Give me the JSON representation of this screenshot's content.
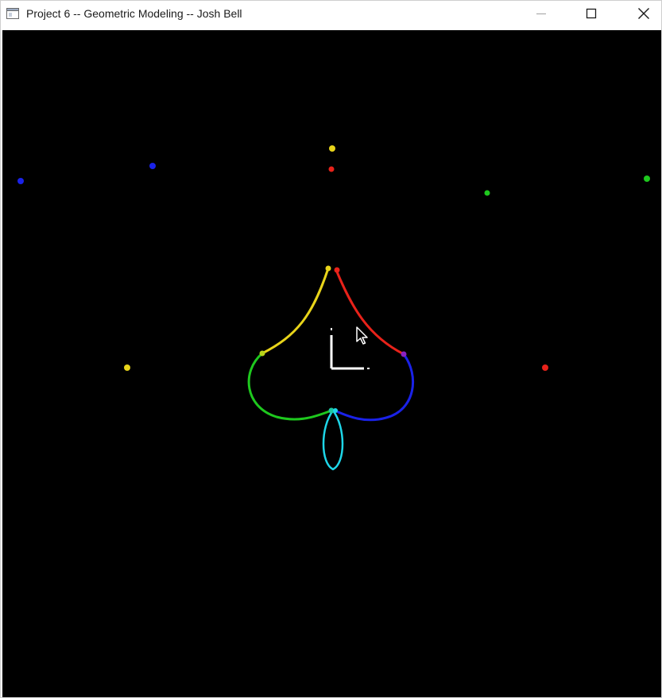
{
  "window": {
    "title": "Project 6 -- Geometric Modeling -- Josh Bell",
    "controls": {
      "minimize_icon": "minimize-icon",
      "maximize_icon": "maximize-icon",
      "close_icon": "close-icon"
    }
  },
  "scene": {
    "background": "#000000",
    "curve_colors": {
      "yellow": "#e8d41a",
      "red": "#e8221a",
      "green": "#1ec81e",
      "blue": "#1a22e8",
      "cyan": "#1ed6e8"
    },
    "axes_color": "#ffffff",
    "cursor": "mouse-pointer-icon"
  }
}
